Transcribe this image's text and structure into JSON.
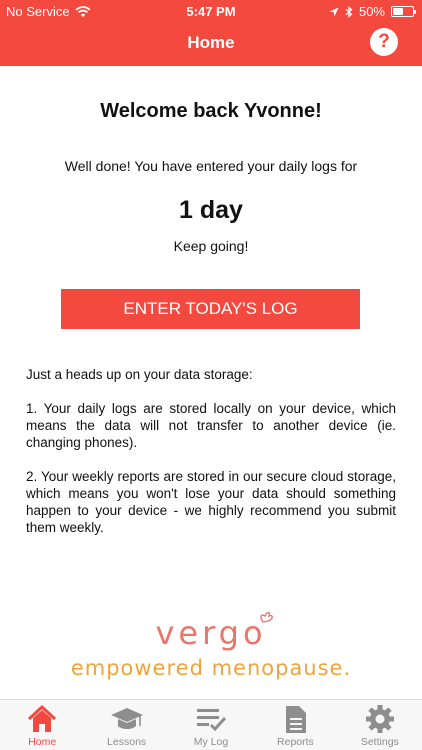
{
  "status": {
    "carrier": "No Service",
    "time": "5:47 PM",
    "battery": "50%",
    "battery_level": 0.5
  },
  "nav": {
    "title": "Home",
    "help_symbol": "?"
  },
  "content": {
    "welcome": "Welcome back Yvonne!",
    "intro": "Well done! You have entered your daily logs for",
    "days": "1 day",
    "keep": "Keep going!",
    "cta": "ENTER TODAY'S LOG",
    "storage_heading": "Just a heads up on your data storage:",
    "storage_point1": "1. Your daily logs are stored locally on your device, which means the data will not transfer to another device (ie. changing phones).",
    "storage_point2": "2. Your weekly reports are stored in our secure cloud storage, which means you won't lose your data should something happen to your device - we highly recommend you submit them weekly."
  },
  "logo": {
    "word": "vergo",
    "tagline": "empowered menopause."
  },
  "tabs": [
    {
      "label": "Home",
      "icon": "home-icon",
      "active": true
    },
    {
      "label": "Lessons",
      "icon": "graduation-cap-icon",
      "active": false
    },
    {
      "label": "My Log",
      "icon": "checklist-icon",
      "active": false
    },
    {
      "label": "Reports",
      "icon": "document-icon",
      "active": false
    },
    {
      "label": "Settings",
      "icon": "gear-icon",
      "active": false
    }
  ],
  "colors": {
    "accent": "#f4493f",
    "logo_word": "#e9766c",
    "logo_tagline": "#f0a33c",
    "tab_inactive": "#8e8e8e"
  }
}
